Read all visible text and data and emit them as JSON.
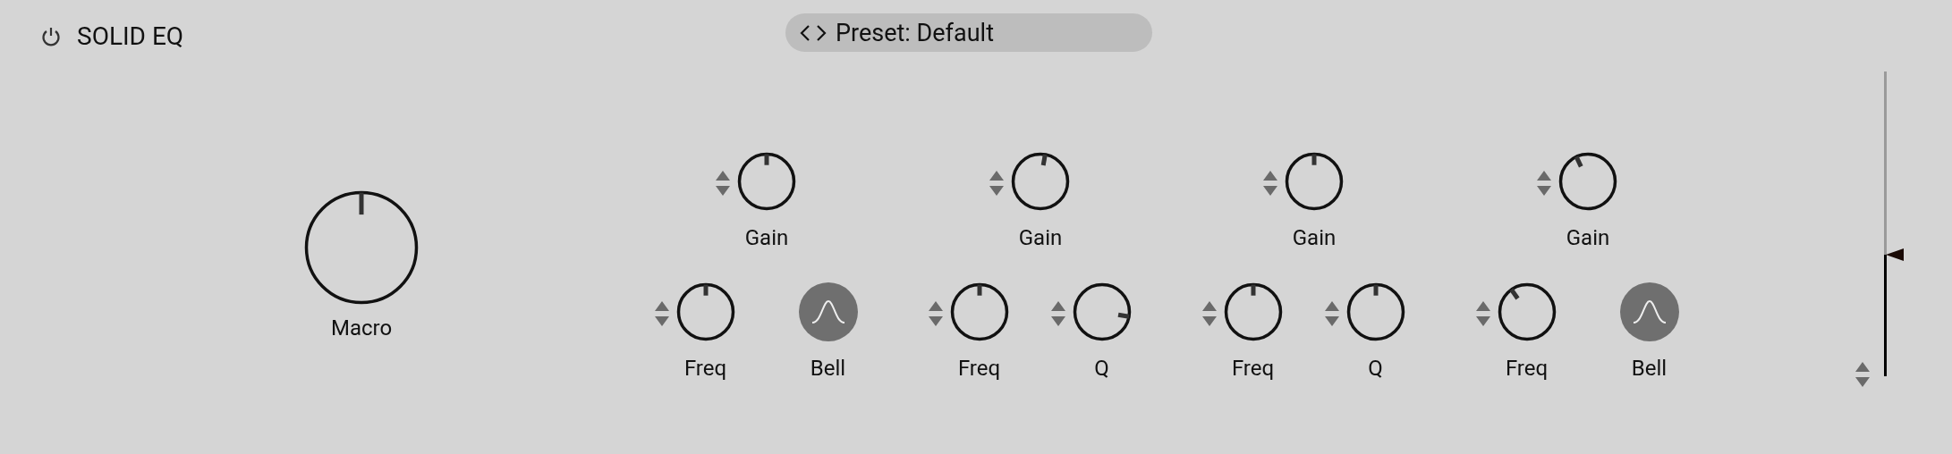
{
  "header": {
    "title": "SOLID EQ",
    "preset": "Preset: Default"
  },
  "macro": {
    "label": "Macro"
  },
  "bands": [
    {
      "gain": {
        "label": "Gain"
      },
      "controls": [
        {
          "kind": "knob",
          "label": "Freq"
        },
        {
          "kind": "shape",
          "label": "Bell"
        }
      ]
    },
    {
      "gain": {
        "label": "Gain"
      },
      "controls": [
        {
          "kind": "knob",
          "label": "Freq"
        },
        {
          "kind": "knob",
          "label": "Q"
        }
      ]
    },
    {
      "gain": {
        "label": "Gain"
      },
      "controls": [
        {
          "kind": "knob",
          "label": "Freq"
        },
        {
          "kind": "knob",
          "label": "Q"
        }
      ]
    },
    {
      "gain": {
        "label": "Gain"
      },
      "controls": [
        {
          "kind": "knob",
          "label": "Freq"
        },
        {
          "kind": "shape",
          "label": "Bell"
        }
      ]
    }
  ],
  "meter": {
    "level": 0.4
  }
}
